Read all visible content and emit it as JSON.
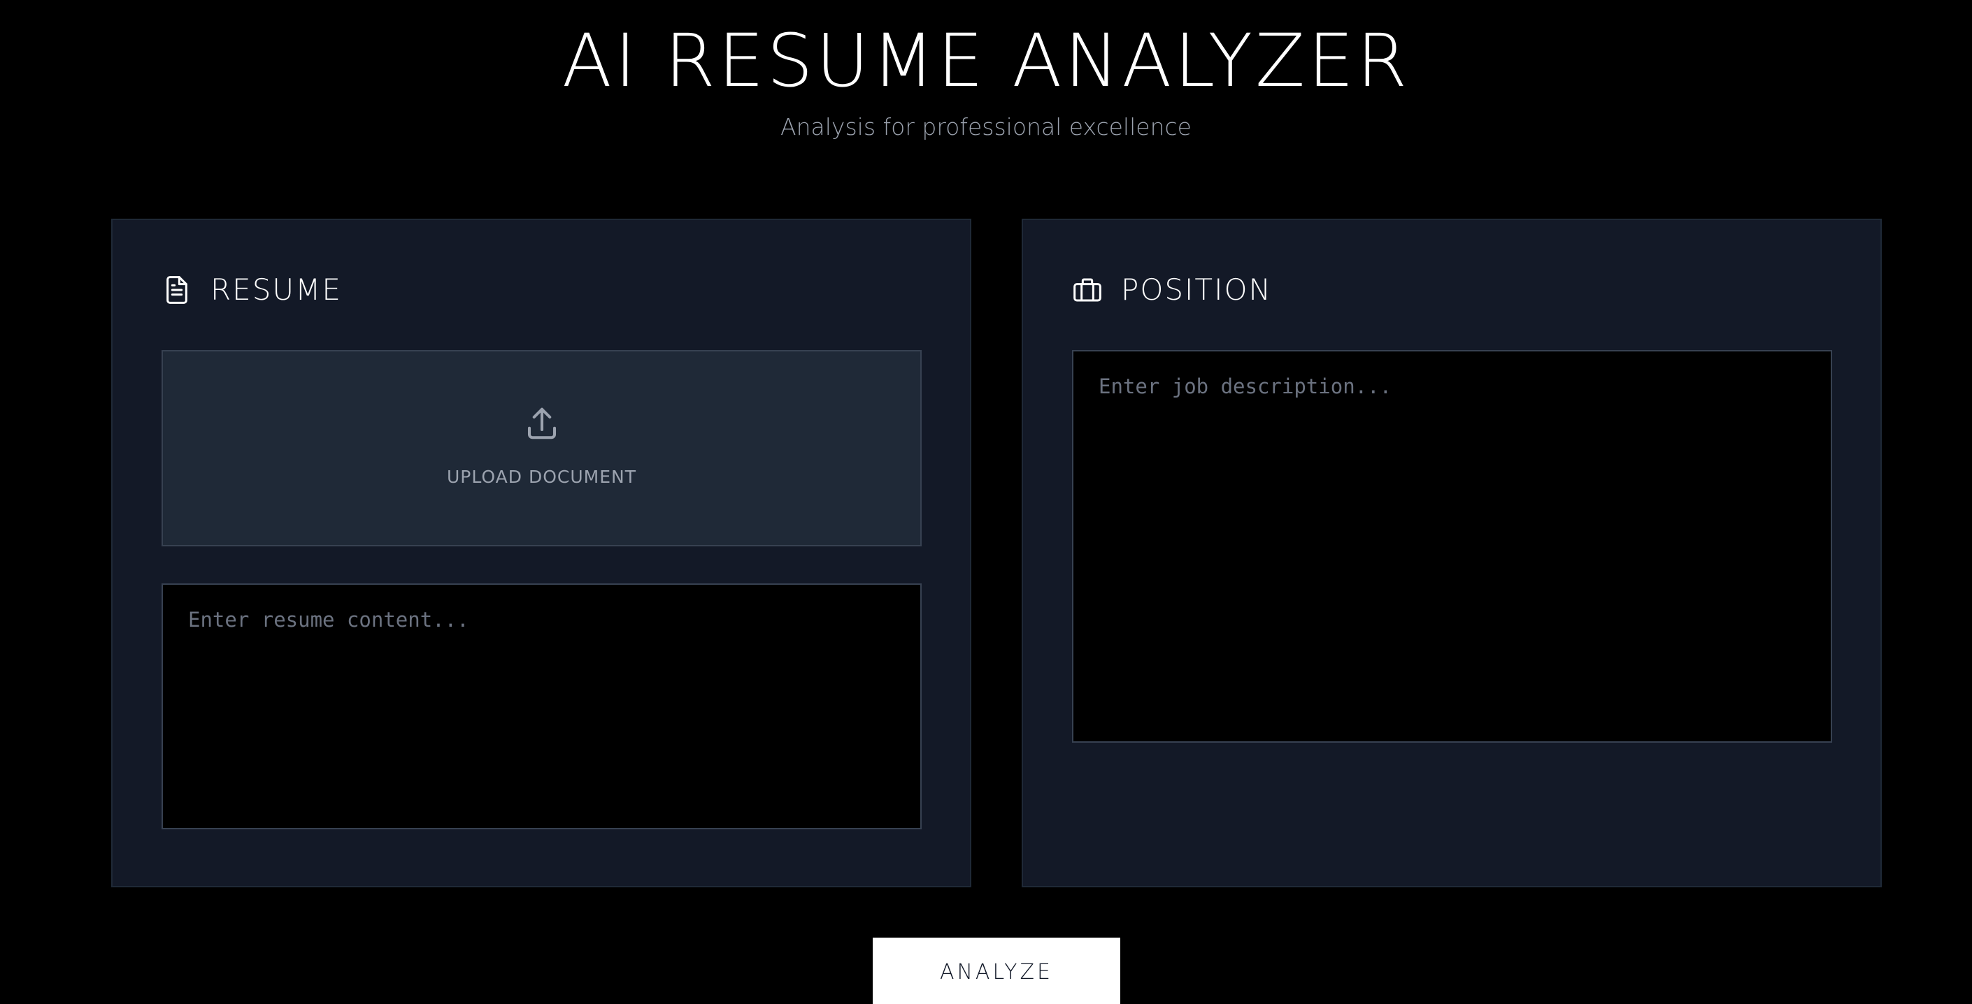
{
  "header": {
    "title": "AI RESUME ANALYZER",
    "subtitle": "Analysis for professional excellence"
  },
  "resume_panel": {
    "heading": "RESUME",
    "heading_icon": "document-icon",
    "upload": {
      "label": "UPLOAD DOCUMENT",
      "icon": "upload-icon"
    },
    "textarea": {
      "value": "",
      "placeholder": "Enter resume content..."
    }
  },
  "position_panel": {
    "heading": "POSITION",
    "heading_icon": "briefcase-icon",
    "textarea": {
      "value": "",
      "placeholder": "Enter job description..."
    }
  },
  "actions": {
    "analyze_label": "ANALYZE"
  },
  "colors": {
    "background": "#000000",
    "panel": "#131927",
    "panel_border": "#1f2937",
    "upload_zone": "#1f2937",
    "muted_text": "#9ca3af",
    "placeholder": "#6b7280",
    "button_bg": "#ffffff"
  }
}
